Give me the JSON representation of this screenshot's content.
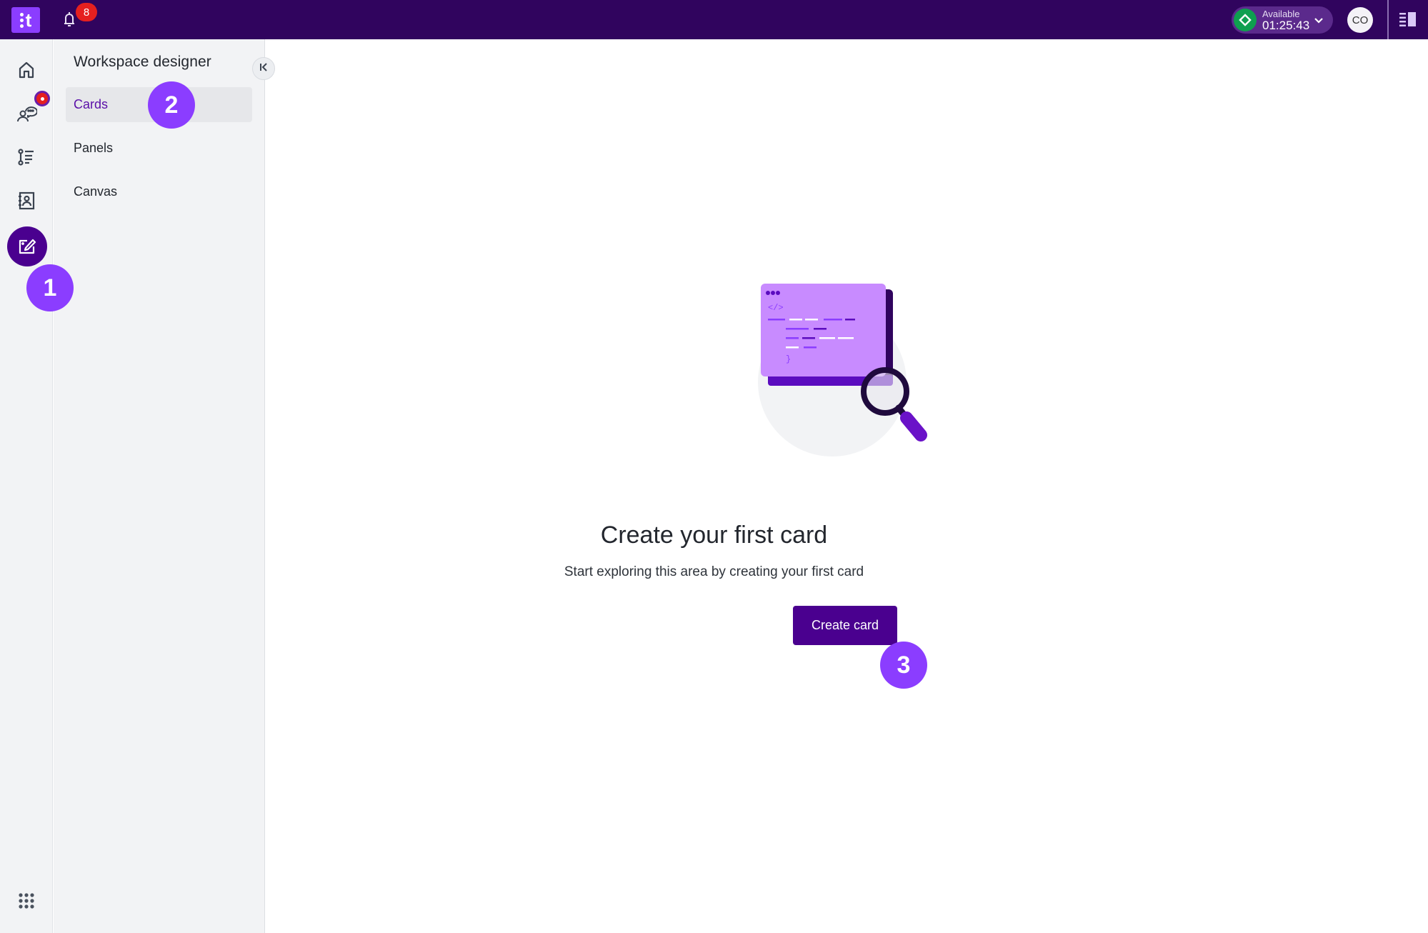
{
  "topbar": {
    "logo_label": "t",
    "notifications": {
      "icon": "bell-icon",
      "count": "8"
    },
    "status": {
      "label": "Available",
      "timer": "01:25:43",
      "color": "#0e9f4f"
    },
    "avatar_initials": "CO",
    "panel_toggle_icon": "side-panel-icon"
  },
  "rail": {
    "items": [
      {
        "name": "home",
        "icon": "home-icon"
      },
      {
        "name": "conversations",
        "icon": "chat-user-icon",
        "badge": true
      },
      {
        "name": "lists",
        "icon": "list-icon"
      },
      {
        "name": "contacts",
        "icon": "contact-book-icon"
      },
      {
        "name": "workspace-designer",
        "icon": "edit-icon",
        "active": true
      }
    ],
    "apps_icon": "apps-grid-icon"
  },
  "sidebar": {
    "title": "Workspace designer",
    "items": [
      {
        "label": "Cards",
        "active": true
      },
      {
        "label": "Panels"
      },
      {
        "label": "Canvas"
      }
    ],
    "collapse_icon": "collapse-left-icon"
  },
  "markers": [
    "1",
    "2",
    "3"
  ],
  "main": {
    "empty_state": {
      "title": "Create your first card",
      "subtitle": "Start exploring this area by creating your first card",
      "button_label": "Create card"
    }
  },
  "colors": {
    "topbar": "#30045e",
    "brand": "#8b3dff",
    "primary": "#4a008f",
    "badge": "#e5201f"
  }
}
